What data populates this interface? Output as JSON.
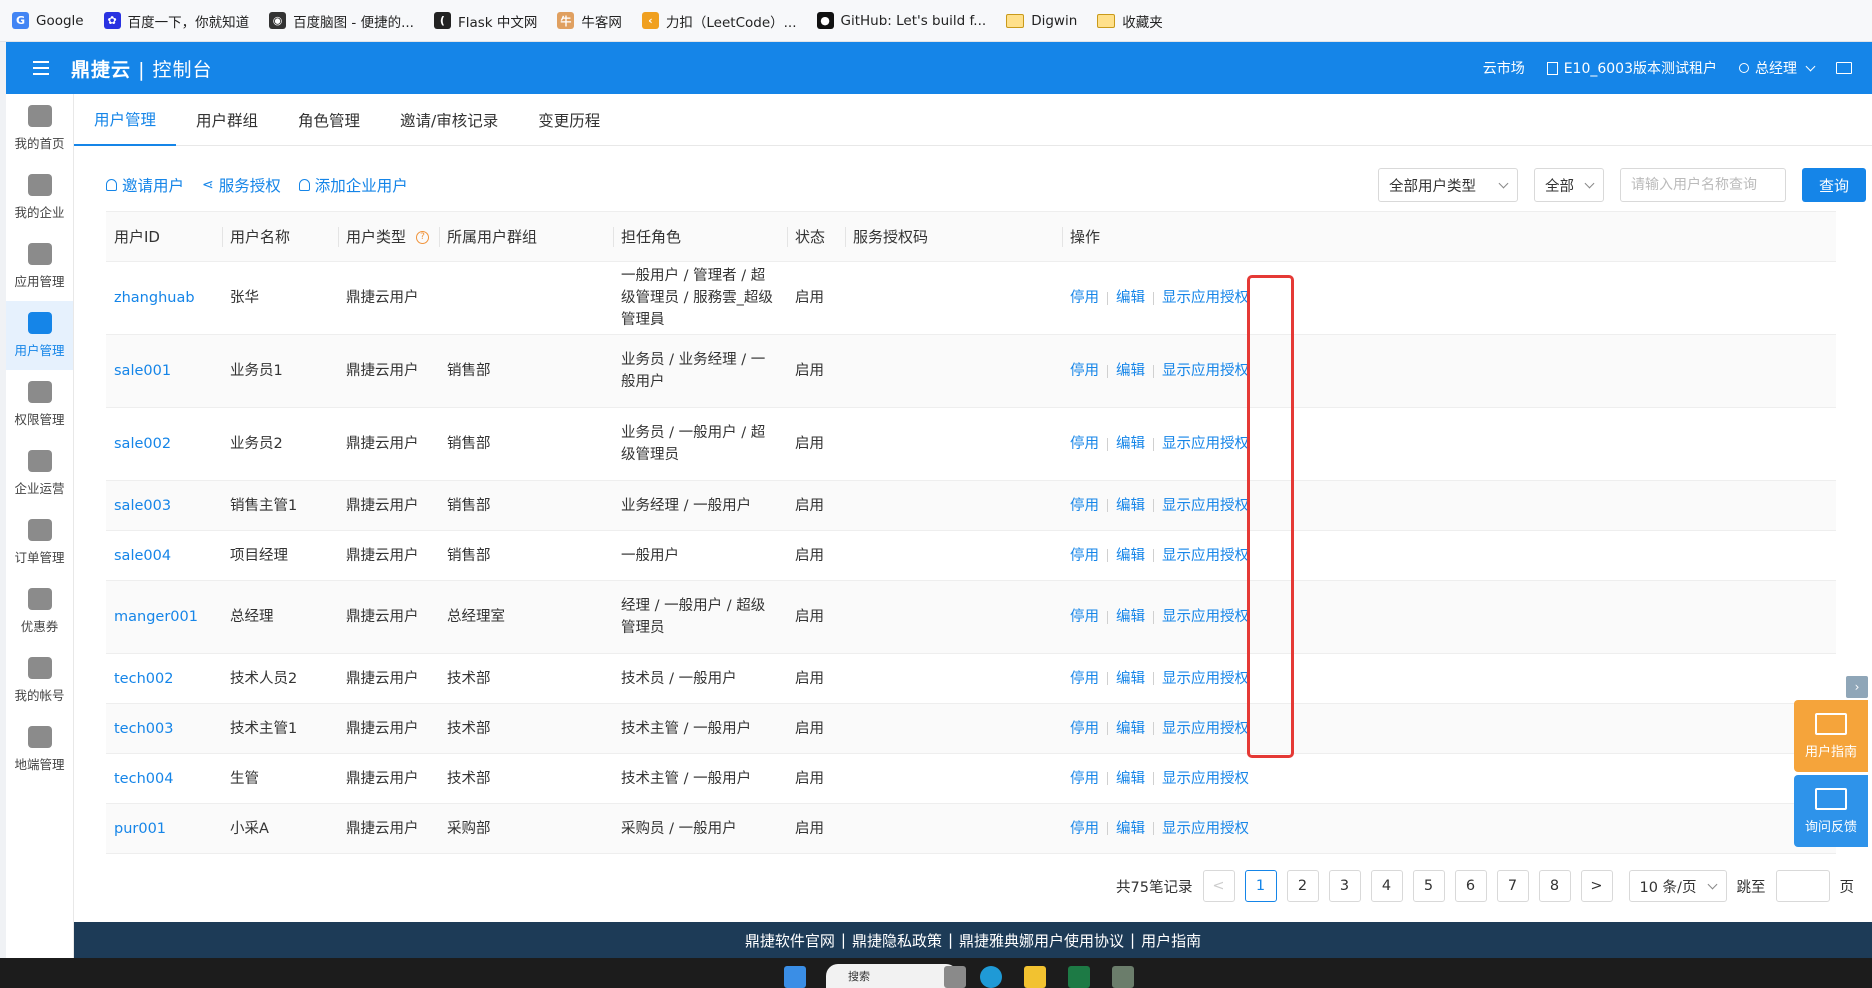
{
  "bookmarks": [
    {
      "label": "Google",
      "icon": "google-icon",
      "color": "#4285f4",
      "glyph": "G"
    },
    {
      "label": "百度一下，你就知道",
      "icon": "baidu-icon",
      "color": "#2932e1",
      "glyph": "✿"
    },
    {
      "label": "百度脑图 - 便捷的...",
      "icon": "naotu-icon",
      "color": "#333333",
      "glyph": "◉"
    },
    {
      "label": "Flask 中文网",
      "icon": "flask-icon",
      "color": "#222222",
      "glyph": "("
    },
    {
      "label": "牛客网",
      "icon": "nowcoder-icon",
      "color": "#e0a060",
      "glyph": "牛"
    },
    {
      "label": "力扣（LeetCode）...",
      "icon": "leetcode-icon",
      "color": "#f0a020",
      "glyph": "‹"
    },
    {
      "label": "GitHub: Let's build f...",
      "icon": "github-icon",
      "color": "#111111",
      "glyph": "●"
    },
    {
      "label": "Digwin",
      "icon": "folder-icon",
      "color": "",
      "glyph": ""
    },
    {
      "label": "收藏夹",
      "icon": "folder-icon",
      "color": "",
      "glyph": ""
    }
  ],
  "header": {
    "brand": "鼎捷云",
    "console": "控制台",
    "market": "云市场",
    "tenant": "E10_6003版本测试租户",
    "user": "总经理"
  },
  "sidenav": [
    {
      "label": "我的首页",
      "icon": "home-icon",
      "active": false
    },
    {
      "label": "我的企业",
      "icon": "building-icon",
      "active": false
    },
    {
      "label": "应用管理",
      "icon": "apps-grid-icon",
      "active": false
    },
    {
      "label": "用户管理",
      "icon": "users-icon",
      "active": true
    },
    {
      "label": "权限管理",
      "icon": "user-lock-icon",
      "active": false
    },
    {
      "label": "企业运营",
      "icon": "globe-icon",
      "active": false
    },
    {
      "label": "订单管理",
      "icon": "order-icon",
      "active": false
    },
    {
      "label": "优惠券",
      "icon": "coupon-icon",
      "active": false
    },
    {
      "label": "我的帐号",
      "icon": "sliders-icon",
      "active": false
    },
    {
      "label": "地端管理",
      "icon": "cloud-icon",
      "active": false
    }
  ],
  "tabs": [
    "用户管理",
    "用户群组",
    "角色管理",
    "邀请/审核记录",
    "变更历程"
  ],
  "toolbar": {
    "invite": "邀请用户",
    "authorize": "服务授权",
    "add_enterprise_user": "添加企业用户",
    "user_type_select": "全部用户类型",
    "status_select": "全部",
    "search_placeholder": "请输入用户名称查询",
    "query": "查询"
  },
  "table": {
    "headers": [
      "用户ID",
      "用户名称",
      "用户类型",
      "所属用户群组",
      "担任角色",
      "状态",
      "服务授权码",
      "操作"
    ],
    "rows": [
      {
        "id": "zhanghuab",
        "name": "张华",
        "type": "鼎捷云用户",
        "group": "",
        "roles": "一般用户 / 管理者 / 超级管理员 / 服務雲_超级管理員",
        "status": "启用",
        "code": ""
      },
      {
        "id": "sale001",
        "name": "业务员1",
        "type": "鼎捷云用户",
        "group": "销售部",
        "roles": "业务员 / 业务经理 / 一般用户",
        "status": "启用",
        "code": ""
      },
      {
        "id": "sale002",
        "name": "业务员2",
        "type": "鼎捷云用户",
        "group": "销售部",
        "roles": "业务员 / 一般用户 / 超级管理员",
        "status": "启用",
        "code": ""
      },
      {
        "id": "sale003",
        "name": "销售主管1",
        "type": "鼎捷云用户",
        "group": "销售部",
        "roles": "业务经理 / 一般用户",
        "status": "启用",
        "code": ""
      },
      {
        "id": "sale004",
        "name": "项目经理",
        "type": "鼎捷云用户",
        "group": "销售部",
        "roles": "一般用户",
        "status": "启用",
        "code": ""
      },
      {
        "id": "manger001",
        "name": "总经理",
        "type": "鼎捷云用户",
        "group": "总经理室",
        "roles": "经理 / 一般用户 / 超级管理员",
        "status": "启用",
        "code": ""
      },
      {
        "id": "tech002",
        "name": "技术人员2",
        "type": "鼎捷云用户",
        "group": "技术部",
        "roles": "技术员 / 一般用户",
        "status": "启用",
        "code": ""
      },
      {
        "id": "tech003",
        "name": "技术主管1",
        "type": "鼎捷云用户",
        "group": "技术部",
        "roles": "技术主管 / 一般用户",
        "status": "启用",
        "code": ""
      },
      {
        "id": "tech004",
        "name": "生管",
        "type": "鼎捷云用户",
        "group": "技术部",
        "roles": "技术主管 / 一般用户",
        "status": "启用",
        "code": ""
      },
      {
        "id": "pur001",
        "name": "小采A",
        "type": "鼎捷云用户",
        "group": "采购部",
        "roles": "采购员 / 一般用户",
        "status": "启用",
        "code": ""
      }
    ],
    "actions": {
      "disable": "停用",
      "edit": "编辑",
      "show_auth": "显示应用授权"
    }
  },
  "pagination": {
    "total": "共75笔记录",
    "prev": "<",
    "pages": [
      "1",
      "2",
      "3",
      "4",
      "5",
      "6",
      "7",
      "8"
    ],
    "current": "1",
    "next": ">",
    "page_size": "10 条/页",
    "jump_label": "跳至",
    "page_unit": "页"
  },
  "footer": [
    "鼎捷软件官网",
    "鼎捷隐私政策",
    "鼎捷雅典娜用户使用协议",
    "用户指南"
  ],
  "floating": {
    "guide": "用户指南",
    "feedback": "询问反馈"
  },
  "taskbar": {
    "search": "搜索"
  },
  "colors": {
    "accent": "#1585e8",
    "footer": "#1d3b57",
    "highlight": "#e53935",
    "guide": "#f5a43b"
  }
}
